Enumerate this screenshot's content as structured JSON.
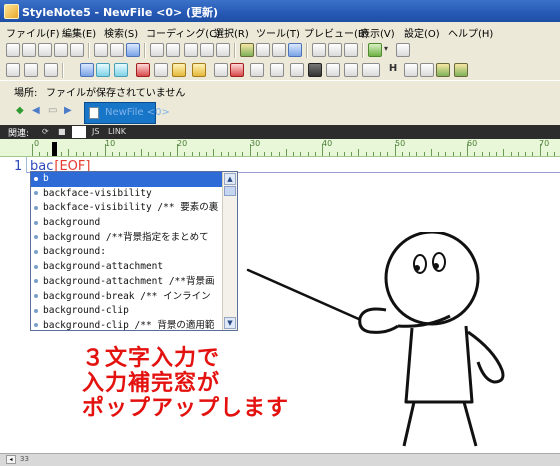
{
  "window": {
    "title": "StyleNote5 - NewFile <0> (更新)"
  },
  "menu": [
    "ファイル(F)",
    "編集(E)",
    "検索(S)",
    "コーディング(C)",
    "選択(R)",
    "ツール(T)",
    "プレビュー(B)",
    "表示(V)",
    "設定(O)",
    "ヘルプ(H)"
  ],
  "toolbar2": {
    "bold_label": "H"
  },
  "location": {
    "label": "場所:",
    "value": "ファイルが保存されていません"
  },
  "tabs": {
    "file_tab": "NewFile <0>"
  },
  "related": {
    "label": "関連:",
    "js": "JS",
    "link": "LINK"
  },
  "ruler": {
    "marks": [
      "0",
      "10",
      "20",
      "30",
      "40",
      "50",
      "60",
      "70"
    ]
  },
  "editor": {
    "line_number": "1",
    "text": "bac",
    "eof": "[EOF]"
  },
  "autocomplete": {
    "items": [
      "b",
      "backface-visibility",
      "backface-visibility  /** 要素の裏",
      "background",
      "background  /**背景指定をまとめて",
      "background:",
      "background-attachment",
      "background-attachment  /**背景画",
      "background-break  /** インライン",
      "background-clip",
      "background-clip  /** 背景の適用範"
    ],
    "selected_index": 0
  },
  "annotation": {
    "lines": [
      "３文字入力で",
      "入力補完窓が",
      "ポップアップします"
    ],
    "color": "#e4120f"
  },
  "statusbar": {
    "info": "33"
  }
}
